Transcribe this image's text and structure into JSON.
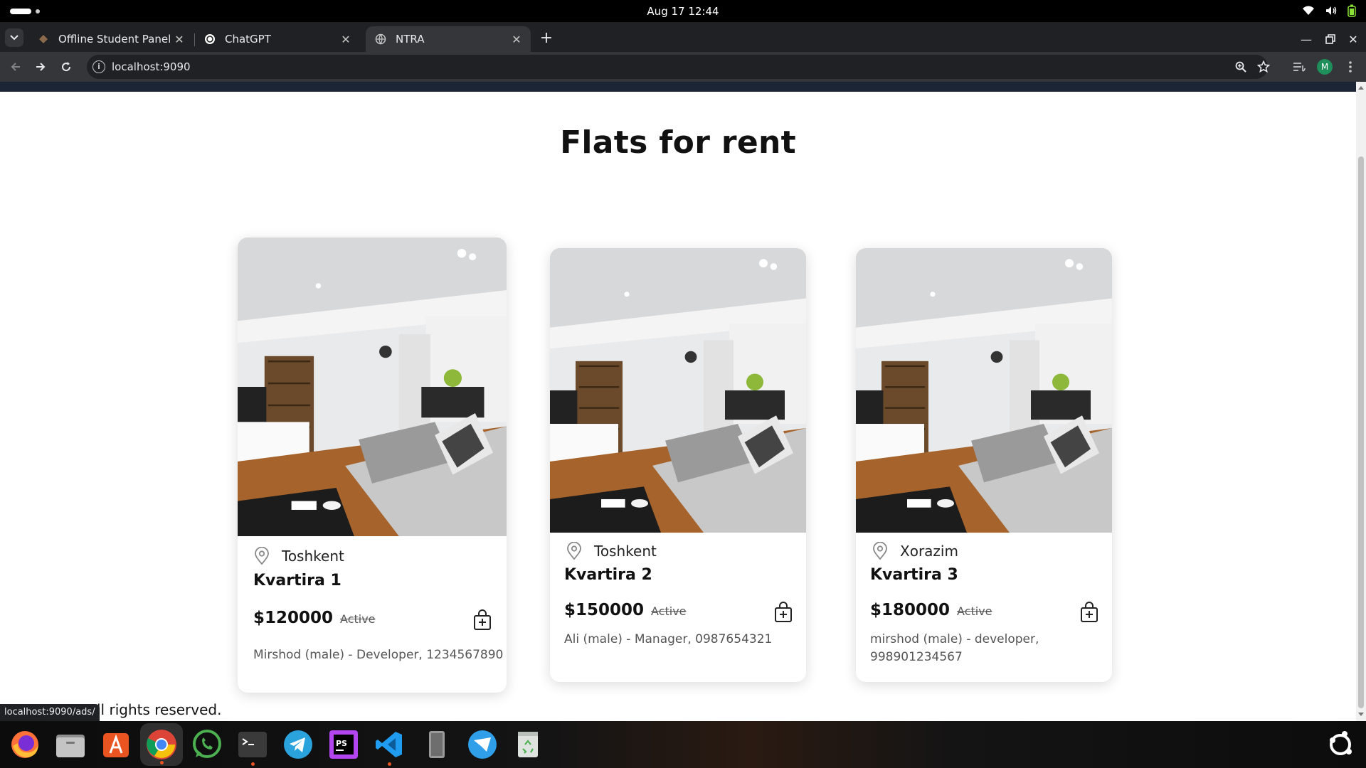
{
  "system": {
    "datetime": "Aug 17  12:44"
  },
  "browser": {
    "tabs": [
      {
        "title": "Offline Student Panel",
        "icon": "diamond-favicon"
      },
      {
        "title": "ChatGPT",
        "icon": "chatgpt-favicon"
      },
      {
        "title": "NTRA",
        "icon": "globe-favicon",
        "active": true
      }
    ],
    "url": "localhost:9090",
    "profile_initial": "M",
    "status_url": "localhost:9090/ads/"
  },
  "page": {
    "heading": "Flats for rent",
    "footer_text": "ll rights reserved.",
    "listings": [
      {
        "location": "Toshkent",
        "title": "Kvartira 1",
        "price": "$120000",
        "status": "Active",
        "owner": "Mirshod (male) - Developer, 1234567890"
      },
      {
        "location": "Toshkent",
        "title": "Kvartira 2",
        "price": "$150000",
        "status": "Active",
        "owner": "Ali (male) - Manager, 0987654321"
      },
      {
        "location": "Xorazim",
        "title": "Kvartira 3",
        "price": "$180000",
        "status": "Active",
        "owner_line1": "mirshod (male) - developer,",
        "owner_line2": "998901234567"
      }
    ]
  },
  "dock": {
    "apps": [
      "firefox-icon",
      "files-icon",
      "app-center-icon",
      "chrome-icon",
      "whatsapp-icon",
      "terminal-icon",
      "telegram-icon",
      "phpstorm-icon",
      "vscode-icon",
      "text-editor-icon",
      "mail-icon",
      "trash-icon"
    ],
    "colors": {
      "accent": "#e95420"
    }
  }
}
